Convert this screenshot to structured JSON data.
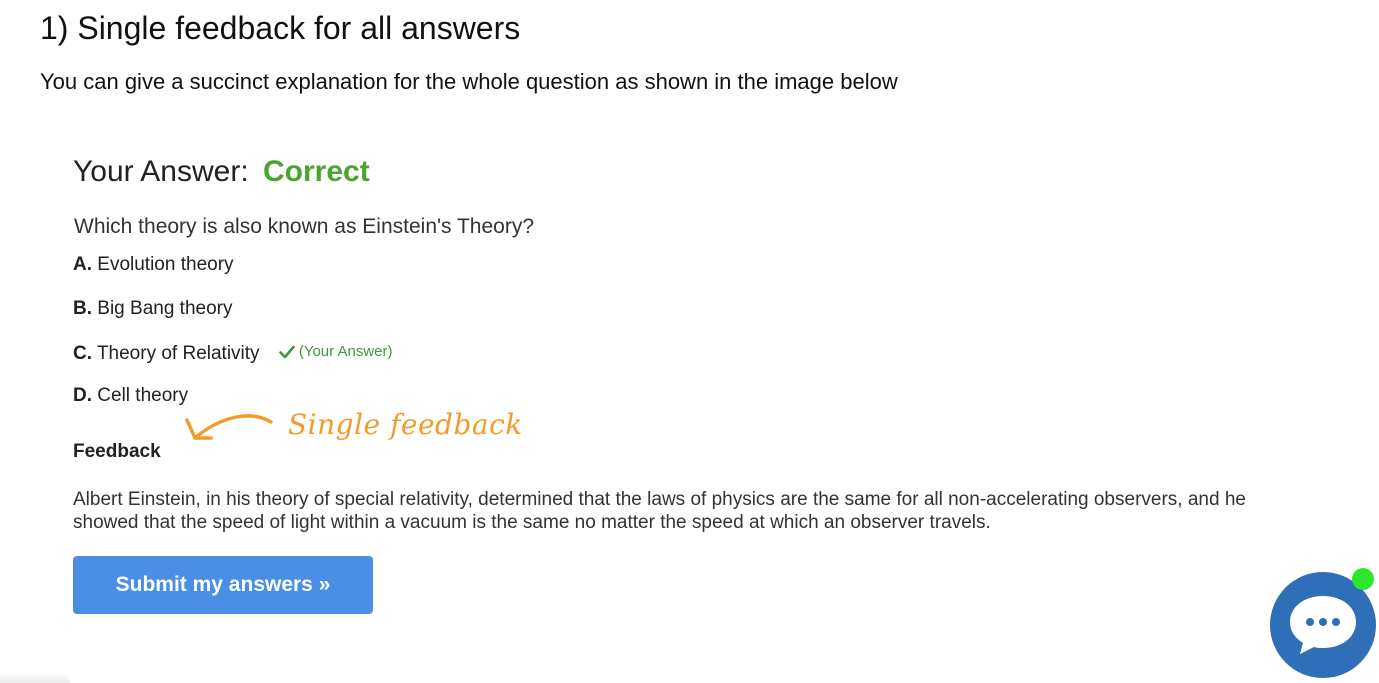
{
  "section": {
    "heading": "1) Single feedback for all answers",
    "intro": "You can give a succinct explanation for the whole question as shown in the image below"
  },
  "quiz": {
    "result_label": "Your Answer:",
    "result_status": "Correct",
    "question": "Which theory is also known as Einstein's Theory?",
    "options": [
      {
        "letter": "A.",
        "text": "Evolution theory"
      },
      {
        "letter": "B.",
        "text": "Big Bang theory"
      },
      {
        "letter": "C.",
        "text": "Theory of Relativity",
        "marker": "(Your Answer)"
      },
      {
        "letter": "D.",
        "text": "Cell theory"
      }
    ],
    "feedback_label": "Feedback",
    "annotation": "Single feedback",
    "feedback_text": "Albert Einstein, in his theory of special relativity, determined that the laws of physics are the same for all non-accelerating observers, and he showed that the speed of light within a vacuum is the same no matter the speed at which an observer travels.",
    "submit_label": "Submit my answers »"
  },
  "chat": {
    "icon": "chat-bubble-icon",
    "status": "online"
  },
  "colors": {
    "correct": "#4aa52e",
    "your_answer": "#3c9a3c",
    "annotation": "#f29b2a",
    "button": "#4a8ee6",
    "chat": "#2e6fb8",
    "online": "#2ee62e"
  },
  "icons": {
    "check": "checkmark-icon",
    "arrow": "curved-arrow-icon"
  }
}
